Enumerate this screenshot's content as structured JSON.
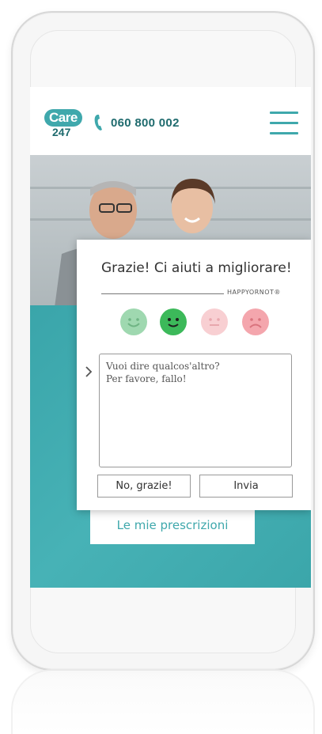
{
  "header": {
    "logo_word": "Care",
    "logo_number": "247",
    "phone": "060 800 002"
  },
  "main": {
    "prescriptions_button": "Le mie prescrizioni"
  },
  "dialog": {
    "title": "Grazie! Ci aiuti a migliorare!",
    "brand": "HAPPYORNOT®",
    "faces": [
      "very-happy",
      "happy",
      "neutral",
      "unhappy"
    ],
    "selected_face": "happy",
    "feedback_placeholder_line1": "Vuoi dire qualcos'altro?",
    "feedback_placeholder_line2": "Per favore, fallo!",
    "no_button": "No, grazie!",
    "send_button": "Invia"
  },
  "colors": {
    "brand_teal": "#3fa8ac",
    "dark_teal": "#1f6b6e",
    "face_green_light": "#9fd8b0",
    "face_green": "#3cb95a",
    "face_pink_light": "#f8cfd2",
    "face_red_light": "#f4a6ad"
  }
}
